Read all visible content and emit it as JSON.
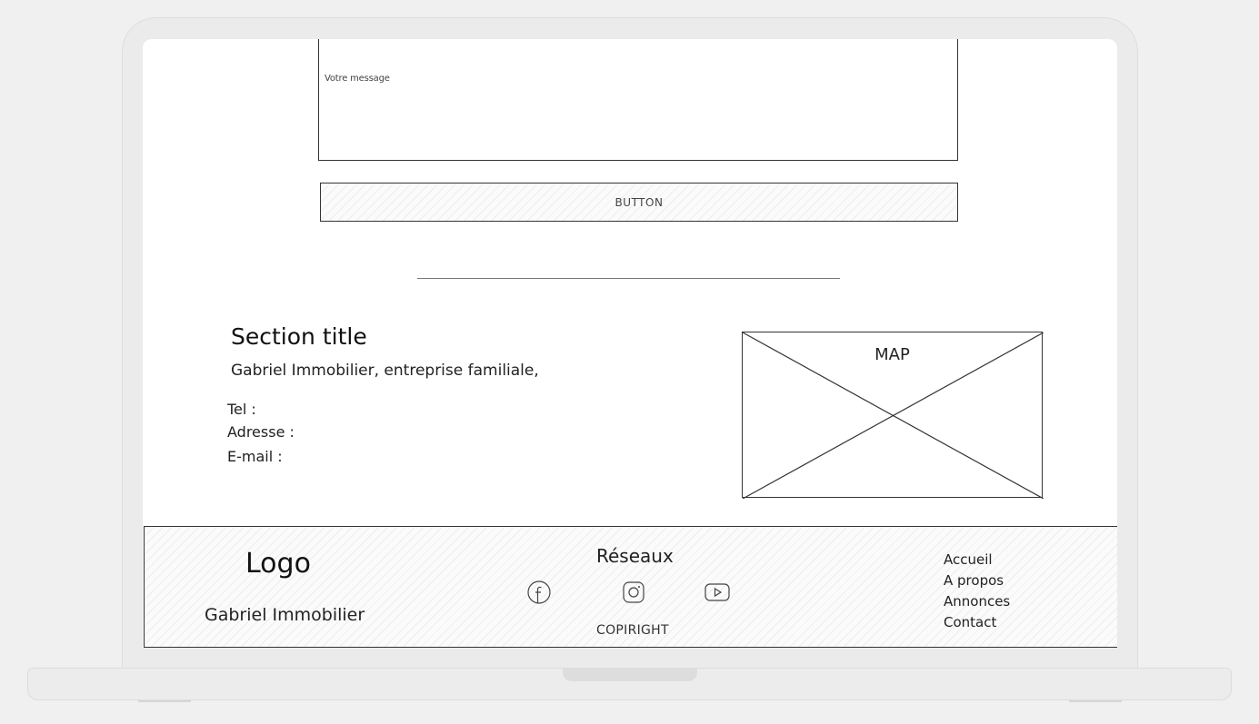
{
  "form": {
    "message_placeholder": "Votre message",
    "button_label": "BUTTON"
  },
  "contact_section": {
    "title": "Section title",
    "subtitle": "Gabriel Immobilier, entreprise familiale,",
    "tel_label": "Tel :",
    "address_label": "Adresse :",
    "email_label": "E-mail :"
  },
  "map": {
    "label": "MAP"
  },
  "footer": {
    "logo": "Logo",
    "company": "Gabriel Immobilier",
    "networks_title": "Réseaux",
    "social_icons": [
      "facebook-icon",
      "instagram-icon",
      "youtube-icon"
    ],
    "copyright": "COPIRIGHT",
    "nav": [
      "Accueil",
      "A propos",
      "Annonces",
      "Contact"
    ]
  }
}
